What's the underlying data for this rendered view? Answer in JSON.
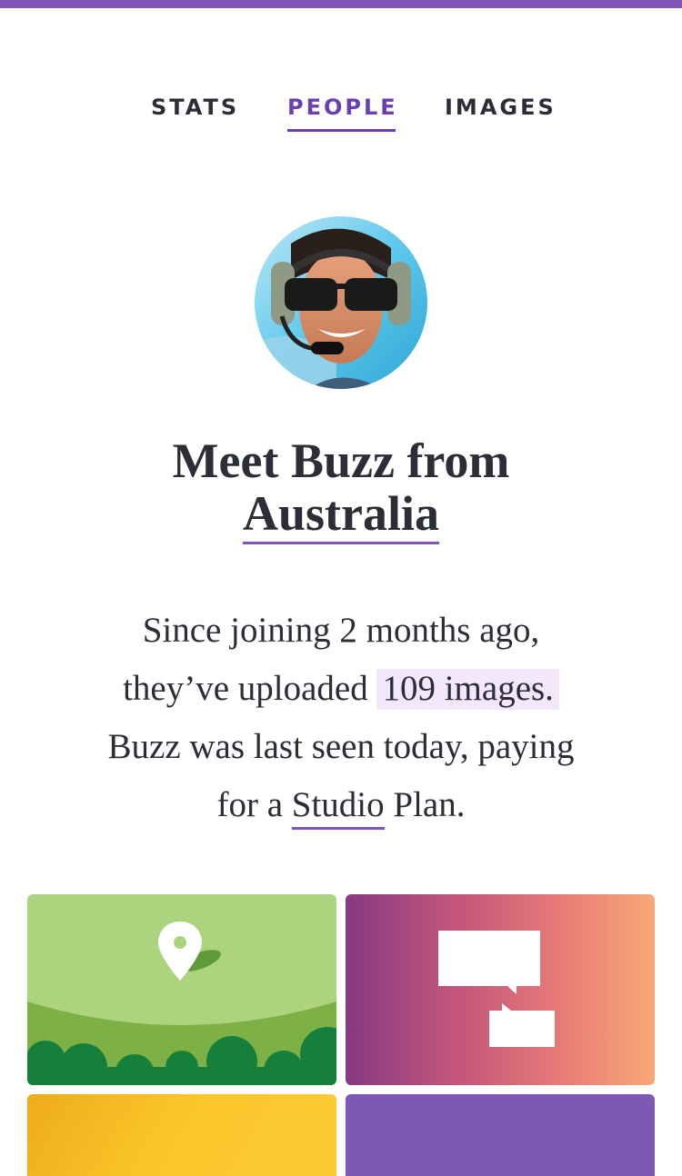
{
  "colors": {
    "accent": "#7e57b8",
    "active_tab": "#6a3fb0",
    "text": "#2b2e36",
    "highlight": "#f3e7fb"
  },
  "tabs": [
    {
      "label": "STATS",
      "active": false
    },
    {
      "label": "PEOPLE",
      "active": true
    },
    {
      "label": "IMAGES",
      "active": false
    }
  ],
  "profile": {
    "headline_prefix": "Meet Buzz from",
    "country": "Australia",
    "summary": {
      "line1": "Since joining 2 months ago,",
      "line2_prefix": "they’ve uploaded",
      "images_count": "109 images.",
      "line3": "Buzz was last seen today, paying",
      "line4_prefix": "for a",
      "plan": "Studio",
      "line4_suffix": "Plan."
    }
  },
  "cards": [
    {
      "icon": "location-pin-icon",
      "color": "#acd47f"
    },
    {
      "icon": "chat-bubbles-icon",
      "color": "#c2557a"
    },
    {
      "icon": "",
      "color": "#fbc52a"
    },
    {
      "icon": "",
      "color": "#7d58b5"
    }
  ]
}
